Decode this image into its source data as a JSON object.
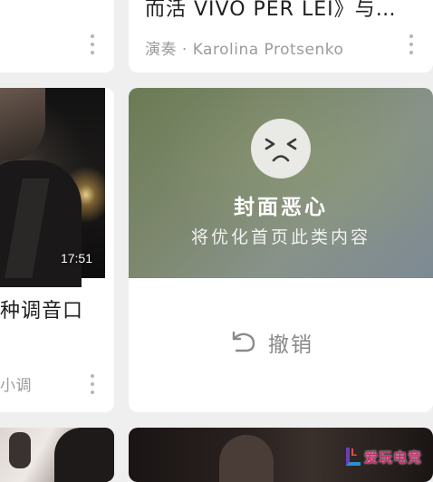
{
  "cards": {
    "top_right": {
      "title": "而活 VIVO PER LEI》与…",
      "subtitle": "演奏 · Karolina Protsenko"
    },
    "mid_left": {
      "duration": "17:51",
      "title": "种调音口",
      "subtitle": "小调"
    },
    "feedback": {
      "title": "封面恶心",
      "message": "将优化首页此类内容",
      "undo_label": "撤销"
    }
  },
  "watermark": {
    "text": "爱玩电竞",
    "letter": "L"
  }
}
